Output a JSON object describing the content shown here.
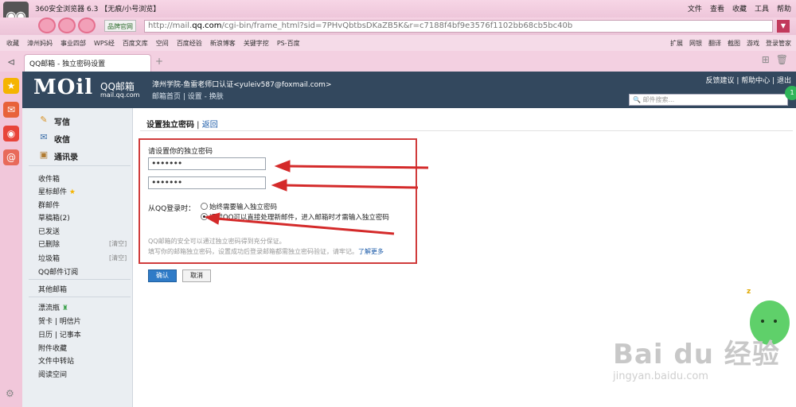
{
  "browser": {
    "title": "360安全浏览器 6.3 【无痕/小号浏览】",
    "menus": [
      "文件",
      "查看",
      "收藏",
      "工具",
      "帮助"
    ],
    "badge": "品牌官网",
    "url_prefix": "http://mail.",
    "url_domain": "qq.com",
    "url_rest": "/cgi-bin/frame_html?sid=7PHvQbtbsDKaZB5K&r=c7188f4bf9e3576f1102bb68cb5bc40b",
    "bookmarks": [
      "收藏",
      "漳州妈妈",
      "事业四部",
      "WPS经",
      "百度文库",
      "空间",
      "百度经验",
      "新浪博客",
      "关键字挖",
      "PS-百度"
    ],
    "bookmarks_right": [
      "扩展",
      "网银",
      "翻译",
      "截图",
      "游戏",
      "登录管家"
    ],
    "tab_label": "QQ邮箱 - 独立密码设置"
  },
  "mail": {
    "logo": "MOil",
    "brand": "QQ邮箱",
    "domain": "mail.qq.com",
    "account": "漳州学院-鱼雷老师口认证<yuleiv587@foxmail.com>",
    "account_links": "邮箱首页 | 设置 - 换肤",
    "top_links": "反馈建议 | 帮助中心 | 退出",
    "search_placeholder": "邮件搜索...",
    "badge": "1"
  },
  "nav": {
    "write": "写信",
    "inbox": "收信",
    "contacts": "通讯录",
    "inbox_box": "收件箱",
    "starred": "星标邮件",
    "group": "群邮件",
    "drafts": "草稿箱(2)",
    "sent": "已发送",
    "deleted": "已删除",
    "spam": "垃圾箱",
    "clear": "[清空]",
    "subscribe": "QQ邮件订阅",
    "other": "其他邮箱",
    "drift": "漂流瓶",
    "cards": "贺卡 | 明信片",
    "calendar": "日历 | 记事本",
    "attachments": "附件收藏",
    "transfer": "文件中转站",
    "reading": "阅读空间"
  },
  "main": {
    "title": "设置独立密码",
    "back": "返回",
    "pw_label": "请设置你的独立密码",
    "pw1": "•••••••",
    "pw2": "•••••••",
    "from_qq": "从QQ登录时：",
    "opt1": "始终需要输入独立密码",
    "opt2": "通过QQ可以直接处理新邮件，进入邮箱时才需输入独立密码",
    "note1": "QQ邮箱的安全可以通过独立密码得到充分保证。",
    "note2": "填写你的邮箱独立密码，设置成功后登录邮箱都需独立密码验证，请牢记。",
    "learn_more": "了解更多",
    "ok": "确认",
    "cancel": "取消"
  },
  "watermark": {
    "main": "Bai du 经验",
    "sub": "jingyan.baidu.com"
  },
  "colors": {
    "mail_header": "#33485e",
    "highlight_box": "#d03c3c",
    "confirm_button": "#2f7bc7"
  }
}
